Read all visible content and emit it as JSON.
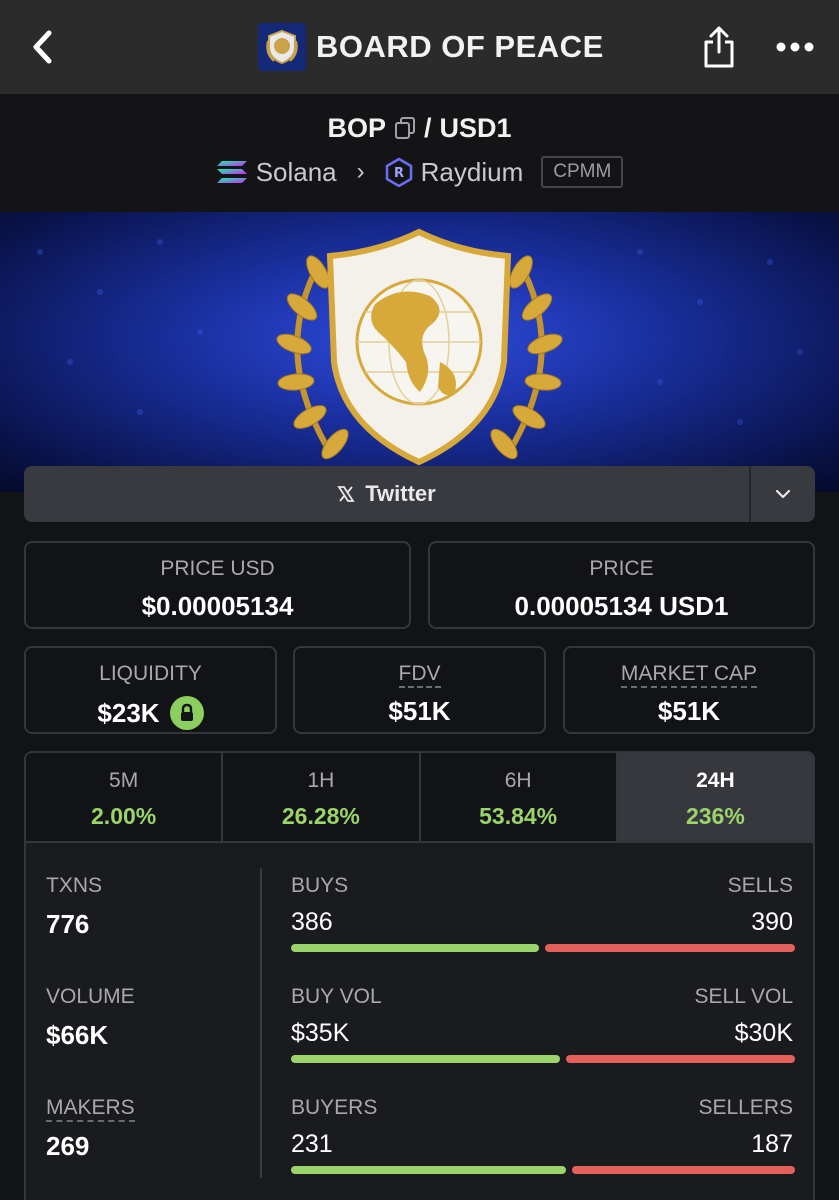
{
  "header": {
    "title": "BOARD OF PEACE",
    "back_icon": "chevron-left-icon",
    "share_icon": "share-icon",
    "more_icon": "more-dots-icon"
  },
  "pair": {
    "base": "BOP",
    "separator": "/",
    "quote": "USD1",
    "chain": "Solana",
    "dex": "Raydium",
    "pool_type": "CPMM"
  },
  "social": {
    "twitter_label": "Twitter"
  },
  "prices": {
    "price_usd_label": "PRICE USD",
    "price_usd_value": "$0.00005134",
    "price_label": "PRICE",
    "price_value": "0.00005134 USD1"
  },
  "metrics": {
    "liquidity_label": "LIQUIDITY",
    "liquidity_value": "$23K",
    "fdv_label": "FDV",
    "fdv_value": "$51K",
    "mcap_label": "MARKET CAP",
    "mcap_value": "$51K"
  },
  "timeframes": [
    {
      "label": "5M",
      "value": "2.00%"
    },
    {
      "label": "1H",
      "value": "26.28%"
    },
    {
      "label": "6H",
      "value": "53.84%"
    },
    {
      "label": "24H",
      "value": "236%"
    }
  ],
  "stats": {
    "txns_label": "TXNS",
    "txns_value": "776",
    "volume_label": "VOLUME",
    "volume_value": "$66K",
    "makers_label": "MAKERS",
    "makers_value": "269",
    "buys_label": "BUYS",
    "buys_value": "386",
    "sells_label": "SELLS",
    "sells_value": "390",
    "buy_vol_label": "BUY VOL",
    "buy_vol_value": "$35K",
    "sell_vol_label": "SELL VOL",
    "sell_vol_value": "$30K",
    "buyers_label": "BUYERS",
    "buyers_value": "231",
    "sellers_label": "SELLERS",
    "sellers_value": "187"
  },
  "ratios": {
    "buys_fraction": 0.497,
    "buy_vol_fraction": 0.54,
    "buyers_fraction": 0.553
  },
  "colors": {
    "positive": "#9bd46a",
    "negative": "#e4605b",
    "background": "#121317"
  }
}
